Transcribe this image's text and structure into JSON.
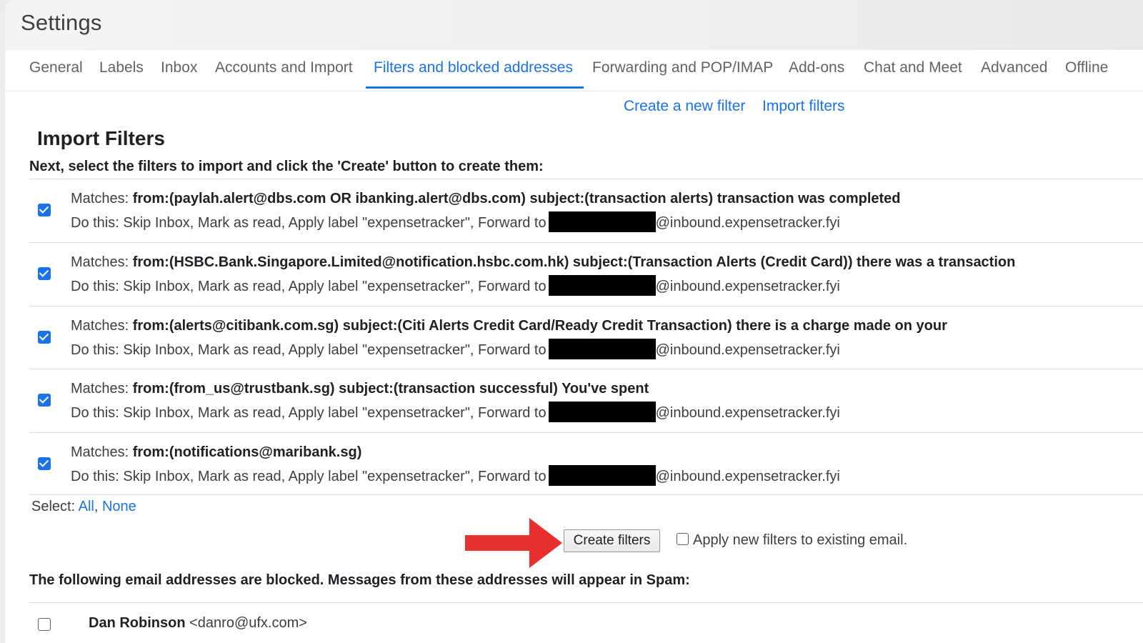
{
  "page_title": "Settings",
  "tabs": [
    {
      "label": "General",
      "active": false
    },
    {
      "label": "Labels",
      "active": false
    },
    {
      "label": "Inbox",
      "active": false
    },
    {
      "label": "Accounts and Import",
      "active": false
    },
    {
      "label": "Filters and blocked addresses",
      "active": true
    },
    {
      "label": "Forwarding and POP/IMAP",
      "active": false
    },
    {
      "label": "Add-ons",
      "active": false
    },
    {
      "label": "Chat and Meet",
      "active": false
    },
    {
      "label": "Advanced",
      "active": false
    },
    {
      "label": "Offline",
      "active": false
    }
  ],
  "actions": {
    "create_new_filter": "Create a new filter",
    "import_filters": "Import filters"
  },
  "section_title": "Import Filters",
  "instruction": "Next, select the filters to import and click the 'Create' button to create them:",
  "filters": [
    {
      "checked": true,
      "matches_label": "Matches:",
      "criteria": "from:(paylah.alert@dbs.com OR ibanking.alert@dbs.com) subject:(transaction alerts) transaction was completed",
      "action_text": "Do this: Skip Inbox, Mark as read, Apply label \"expensetracker\", Forward to",
      "forward_domain": "@inbound.expensetracker.fyi"
    },
    {
      "checked": true,
      "matches_label": "Matches:",
      "criteria": "from:(HSBC.Bank.Singapore.Limited@notification.hsbc.com.hk) subject:(Transaction Alerts (Credit Card)) there was a transaction",
      "action_text": "Do this: Skip Inbox, Mark as read, Apply label \"expensetracker\", Forward to",
      "forward_domain": "@inbound.expensetracker.fyi"
    },
    {
      "checked": true,
      "matches_label": "Matches:",
      "criteria": "from:(alerts@citibank.com.sg) subject:(Citi Alerts Credit Card/Ready Credit Transaction) there is a charge made on your",
      "action_text": "Do this: Skip Inbox, Mark as read, Apply label \"expensetracker\", Forward to",
      "forward_domain": "@inbound.expensetracker.fyi"
    },
    {
      "checked": true,
      "matches_label": "Matches:",
      "criteria": "from:(from_us@trustbank.sg) subject:(transaction successful) You've spent",
      "action_text": "Do this: Skip Inbox, Mark as read, Apply label \"expensetracker\", Forward to",
      "forward_domain": "@inbound.expensetracker.fyi"
    },
    {
      "checked": true,
      "matches_label": "Matches:",
      "criteria": "from:(notifications@maribank.sg)",
      "action_text": "Do this: Skip Inbox, Mark as read, Apply label \"expensetracker\", Forward to",
      "forward_domain": "@inbound.expensetracker.fyi"
    }
  ],
  "select": {
    "label": "Select:",
    "all": "All",
    "separator": ",",
    "none": "None"
  },
  "create_button": "Create filters",
  "apply_existing": {
    "label": "Apply new filters to existing email.",
    "checked": false
  },
  "blocked_title": "The following email addresses are blocked. Messages from these addresses will appear in Spam:",
  "blocked": [
    {
      "name": "Dan Robinson",
      "email": "<danro@ufx.com>",
      "checked": false
    }
  ],
  "colors": {
    "accent": "#1a73e8",
    "arrow": "#e8312f",
    "redaction": "#000000"
  }
}
